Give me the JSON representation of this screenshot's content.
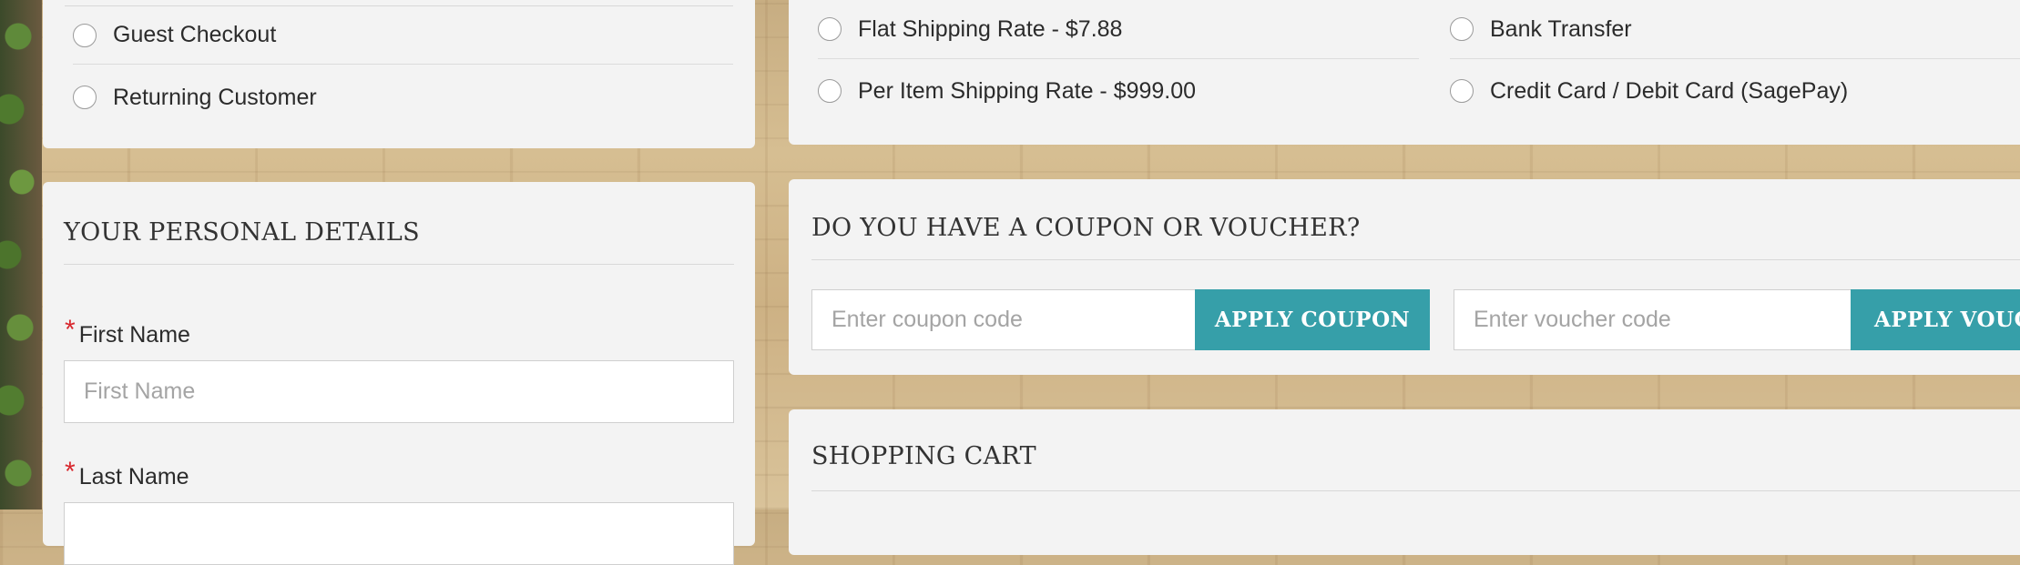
{
  "customer_options": {
    "items": [
      {
        "label": "Guest Checkout"
      },
      {
        "label": "Returning Customer"
      }
    ]
  },
  "shipping_methods": {
    "items": [
      {
        "label": "Flat Shipping Rate - $7.88"
      },
      {
        "label": "Per Item Shipping Rate - $999.00"
      }
    ]
  },
  "payment_methods": {
    "items": [
      {
        "label": "Bank Transfer"
      },
      {
        "label": "Credit Card / Debit Card (SagePay)"
      }
    ]
  },
  "personal_details": {
    "heading": "YOUR PERSONAL DETAILS",
    "required_marker": "*",
    "first_name": {
      "label": "First Name",
      "placeholder": "First Name"
    },
    "last_name": {
      "label": "Last Name"
    }
  },
  "coupon": {
    "heading": "DO YOU HAVE A COUPON OR VOUCHER?",
    "coupon_placeholder": "Enter coupon code",
    "apply_coupon_label": "APPLY COUPON",
    "voucher_placeholder": "Enter voucher code",
    "apply_voucher_label": "APPLY VOUCHER"
  },
  "cart": {
    "heading": "SHOPPING CART"
  },
  "colors": {
    "accent": "#369fa9",
    "required": "#d8272d",
    "panel": "#f3f3f3"
  }
}
